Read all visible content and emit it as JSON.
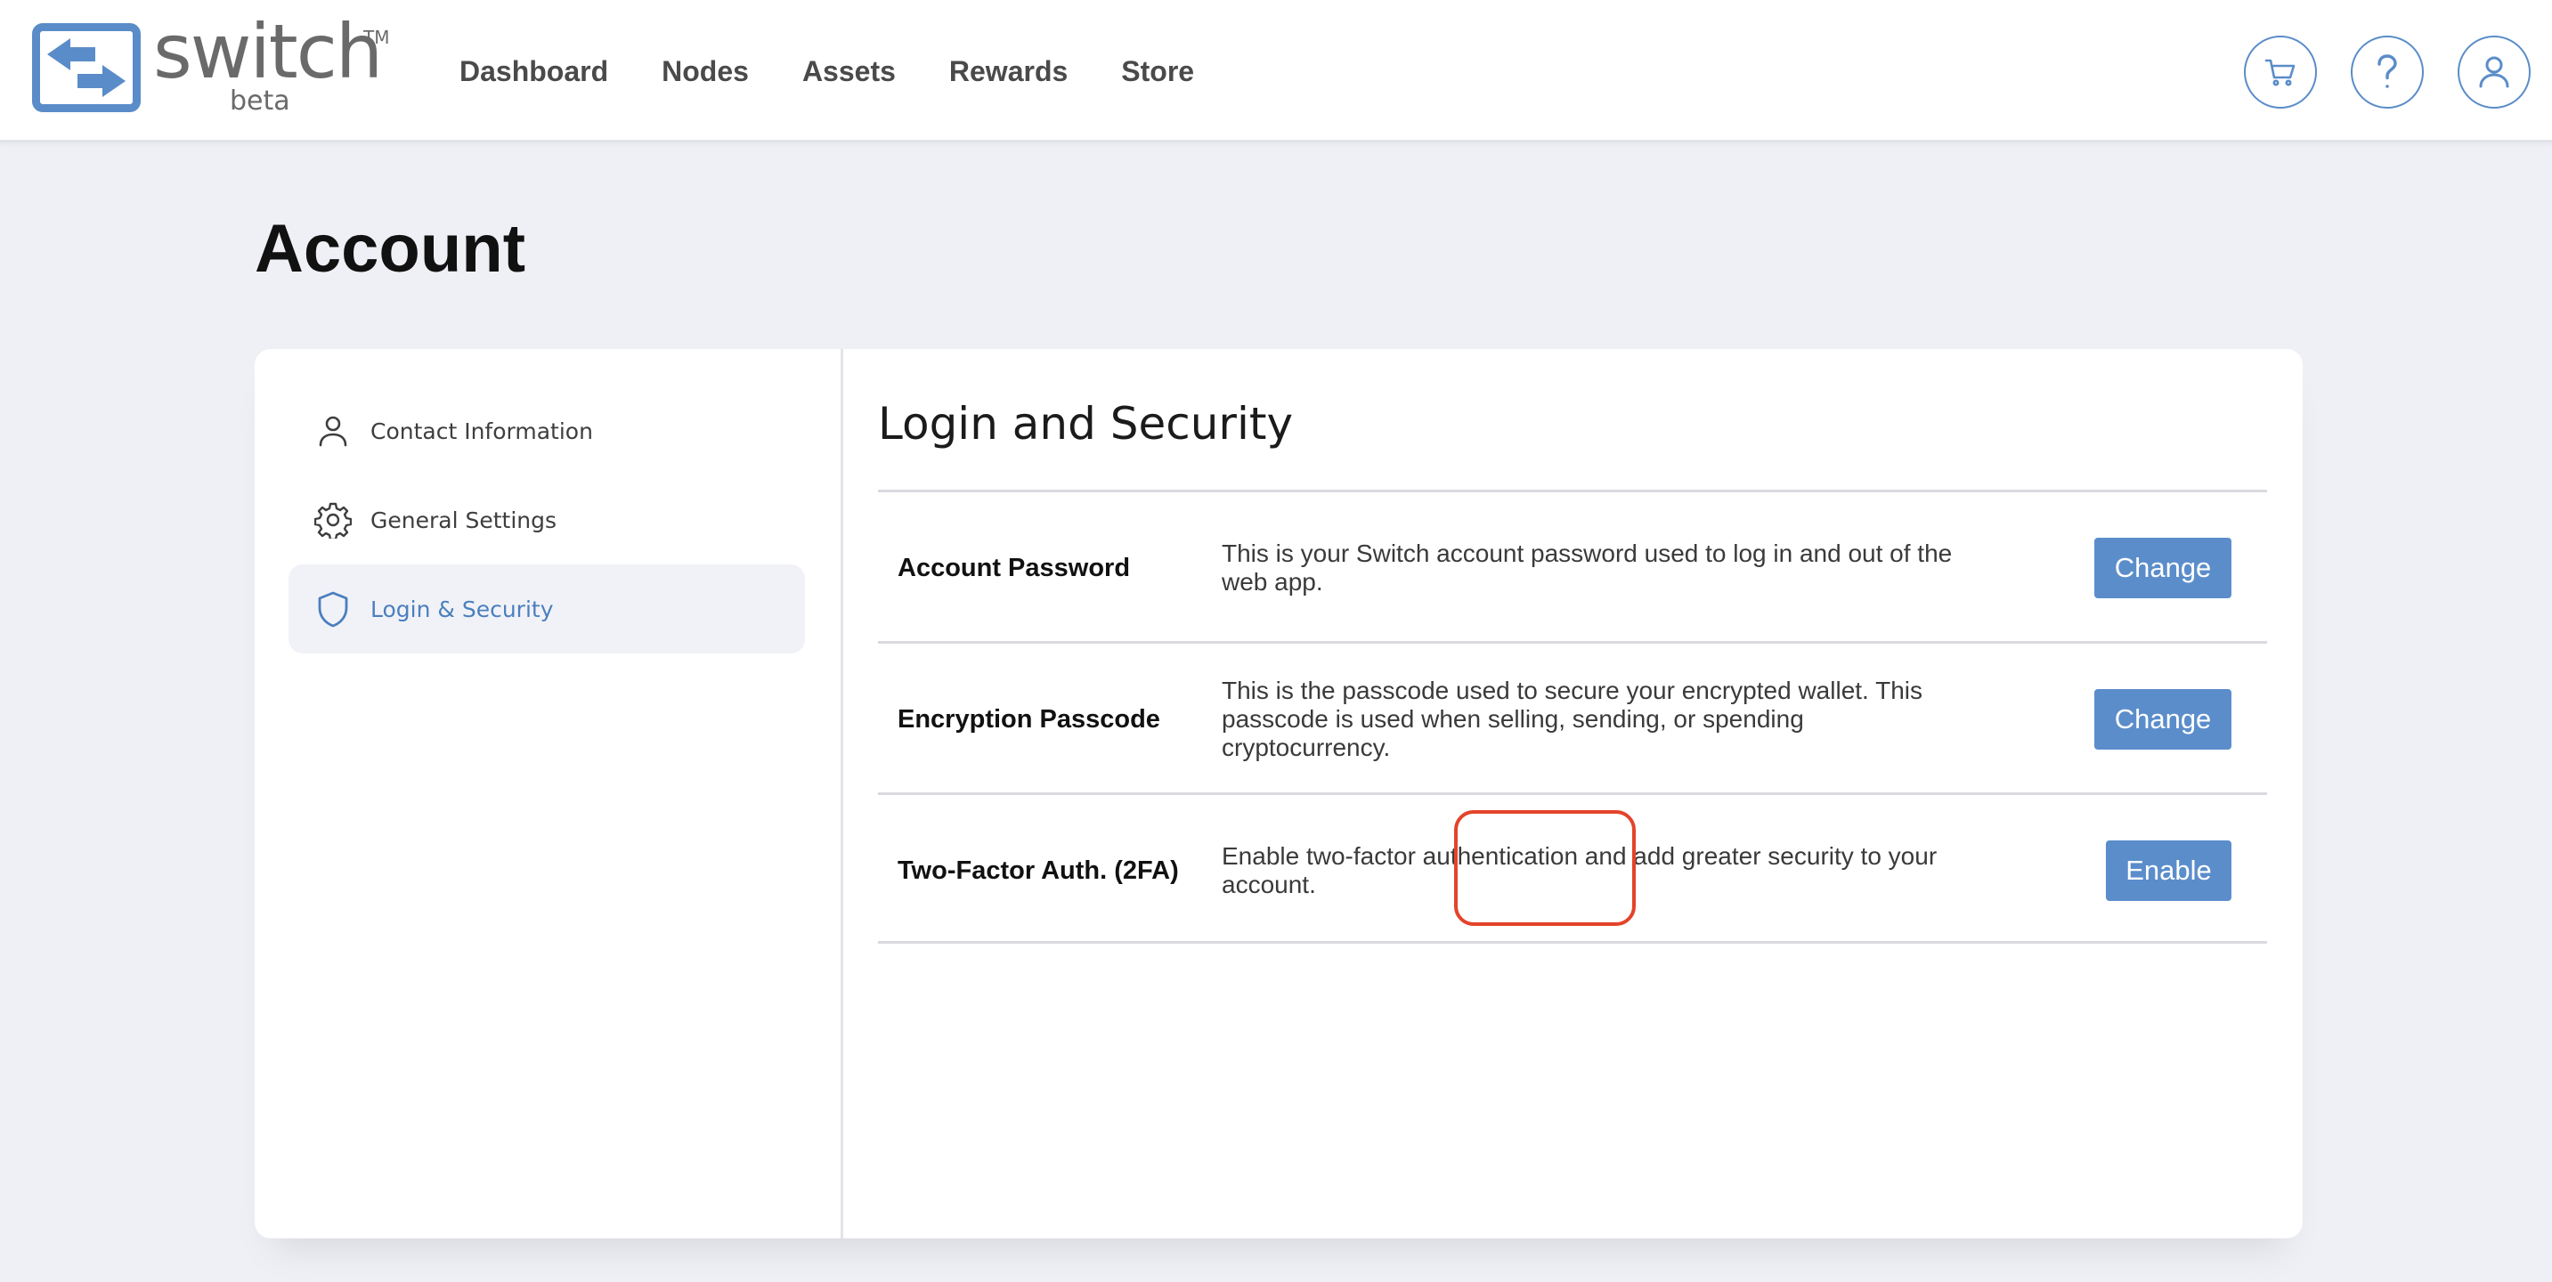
{
  "brand": {
    "name": "switch",
    "tm": "TM",
    "sub": "beta",
    "color": "#5a8cc9"
  },
  "nav": {
    "items": [
      {
        "label": "Dashboard"
      },
      {
        "label": "Nodes"
      },
      {
        "label": "Assets"
      },
      {
        "label": "Rewards"
      },
      {
        "label": "Store"
      }
    ]
  },
  "header_icons": [
    "cart-icon",
    "help-icon",
    "user-icon"
  ],
  "page": {
    "title": "Account"
  },
  "sidebar": {
    "items": [
      {
        "label": "Contact Information",
        "icon": "user-icon",
        "active": false
      },
      {
        "label": "General Settings",
        "icon": "gear-icon",
        "active": false
      },
      {
        "label": "Login & Security",
        "icon": "shield-icon",
        "active": true
      }
    ]
  },
  "security": {
    "title": "Login and Security",
    "rows": [
      {
        "label": "Account Password",
        "description": "This is your Switch account password used to log in and out of the web app.",
        "button": "Change"
      },
      {
        "label": "Encryption Passcode",
        "description": "This is the passcode used to secure your encrypted wallet. This passcode is used when selling, sending, or spending cryptocurrency.",
        "button": "Change"
      },
      {
        "label": "Two-Factor Auth. (2FA)",
        "description": "Enable two-factor authentication and add greater security to your account.",
        "button": "Enable"
      }
    ]
  },
  "colors": {
    "accent": "#5b8dcb",
    "highlight": "#e4432a",
    "background": "#eff0f5"
  }
}
